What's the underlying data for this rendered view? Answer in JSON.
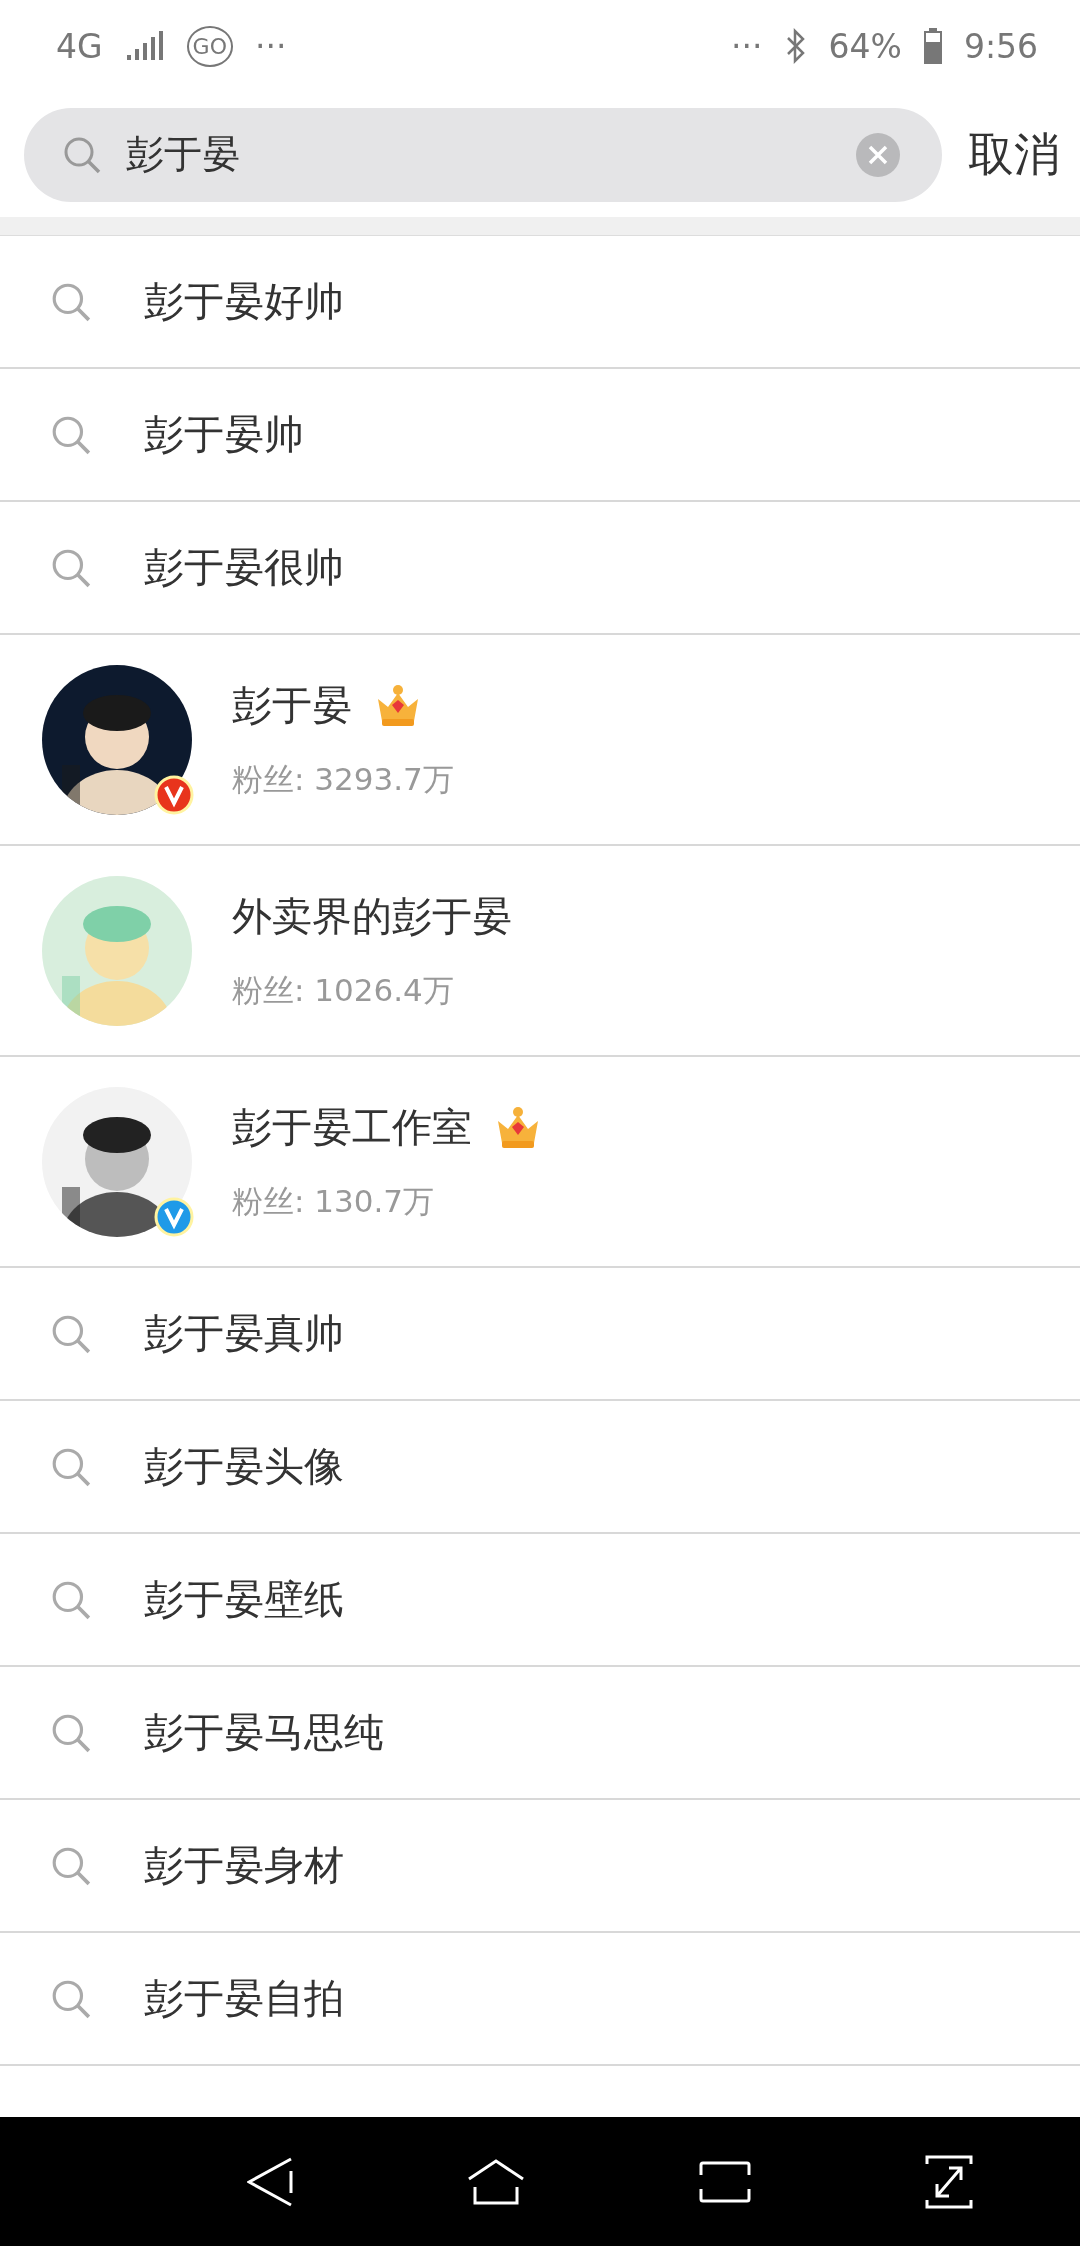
{
  "status_bar": {
    "network": "4G",
    "carrier_badge": "GO",
    "left_more": "···",
    "right_more": "···",
    "battery": "64%",
    "time": "9:56"
  },
  "search": {
    "value": "彭于晏",
    "cancel": "取消"
  },
  "results": [
    {
      "kind": "suggestion",
      "text": "彭于晏好帅"
    },
    {
      "kind": "suggestion",
      "text": "彭于晏帅"
    },
    {
      "kind": "suggestion",
      "text": "彭于晏很帅"
    },
    {
      "kind": "user",
      "name": "彭于晏",
      "crown": true,
      "fans": "粉丝: 3293.7万",
      "color": "#e8341c"
    },
    {
      "kind": "user",
      "name": "外卖界的彭于晏",
      "crown": false,
      "fans": "粉丝: 1026.4万"
    },
    {
      "kind": "user",
      "name": "彭于晏工作室",
      "crown": true,
      "fans": "粉丝: 130.7万",
      "color": "#1f9ae8"
    },
    {
      "kind": "suggestion",
      "text": "彭于晏真帅"
    },
    {
      "kind": "suggestion",
      "text": "彭于晏头像"
    },
    {
      "kind": "suggestion",
      "text": "彭于晏壁纸"
    },
    {
      "kind": "suggestion",
      "text": "彭于晏马思纯"
    },
    {
      "kind": "suggestion",
      "text": "彭于晏身材"
    },
    {
      "kind": "suggestion",
      "text": "彭于晏自拍"
    }
  ]
}
